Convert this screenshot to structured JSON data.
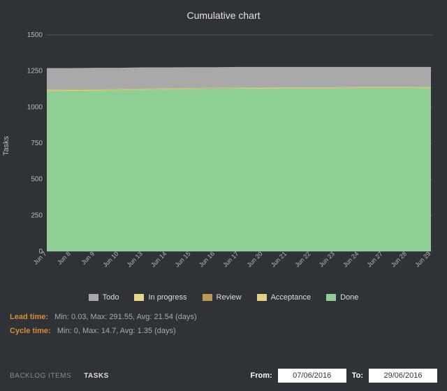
{
  "title": "Cumulative chart",
  "ylabel": "Tasks",
  "chart_data": {
    "type": "area",
    "xlabel": "",
    "ylabel": "Tasks",
    "title": "Cumulative chart",
    "ylim": [
      0,
      1500
    ],
    "yticks": [
      0,
      250,
      500,
      750,
      1000,
      1250,
      1500
    ],
    "categories": [
      "Jun 7",
      "Jun 8",
      "Jun 9",
      "Jun 10",
      "Jun 13",
      "Jun 14",
      "Jun 15",
      "Jun 16",
      "Jun 17",
      "Jun 20",
      "Jun 21",
      "Jun 22",
      "Jun 23",
      "Jun 24",
      "Jun 27",
      "Jun 28",
      "Jun 29"
    ],
    "series": [
      {
        "name": "Todo",
        "color": "#a9a9a9",
        "values": [
          1270,
          1270,
          1272,
          1272,
          1275,
          1275,
          1276,
          1276,
          1278,
          1278,
          1278,
          1278,
          1278,
          1278,
          1278,
          1278,
          1278
        ]
      },
      {
        "name": "In progress",
        "color": "#e6d58a",
        "values": [
          1120,
          1122,
          1122,
          1124,
          1128,
          1130,
          1132,
          1134,
          1136,
          1136,
          1138,
          1138,
          1138,
          1140,
          1140,
          1140,
          1142
        ]
      },
      {
        "name": "Review",
        "color": "#b79a56",
        "values": [
          1118,
          1120,
          1120,
          1122,
          1126,
          1128,
          1130,
          1132,
          1134,
          1134,
          1136,
          1136,
          1136,
          1138,
          1138,
          1138,
          1140
        ]
      },
      {
        "name": "Acceptance",
        "color": "#e0cf86",
        "values": [
          1116,
          1118,
          1118,
          1120,
          1124,
          1126,
          1128,
          1130,
          1132,
          1132,
          1134,
          1134,
          1134,
          1136,
          1136,
          1136,
          1138
        ]
      },
      {
        "name": "Done",
        "color": "#8fcf94",
        "values": [
          1110,
          1112,
          1114,
          1116,
          1120,
          1122,
          1126,
          1128,
          1130,
          1128,
          1130,
          1130,
          1130,
          1132,
          1132,
          1132,
          1134
        ]
      }
    ]
  },
  "legend": [
    {
      "label": "Todo",
      "color": "#a9a9a9"
    },
    {
      "label": "In progress",
      "color": "#e6d58a"
    },
    {
      "label": "Review",
      "color": "#b79a56"
    },
    {
      "label": "Acceptance",
      "color": "#e0cf86"
    },
    {
      "label": "Done",
      "color": "#8fcf94"
    }
  ],
  "lead_label": "Lead time:",
  "lead_value": "Min: 0.03, Max: 291.55, Avg: 21.54 (days)",
  "cycle_label": "Cycle time:",
  "cycle_value": "Min: 0, Max: 14.7, Avg: 1.35 (days)",
  "tabs": {
    "backlog": "BACKLOG ITEMS",
    "tasks": "TASKS",
    "active": "tasks"
  },
  "date_from_label": "From:",
  "date_from_value": "07/06/2016",
  "date_to_label": "To:",
  "date_to_value": "29/06/2016"
}
